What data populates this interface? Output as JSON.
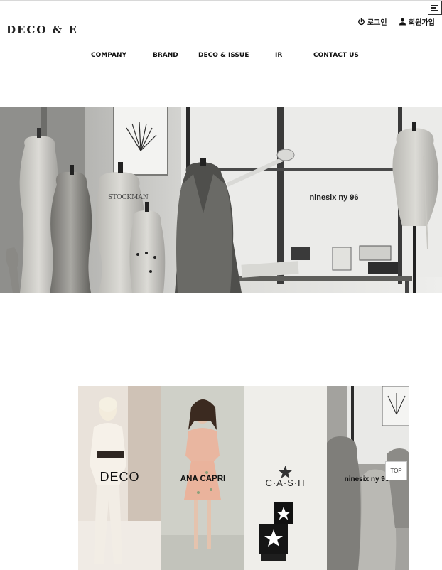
{
  "header": {
    "logo": "DECO & E",
    "util": {
      "login": "로그인",
      "join": "회원가입"
    }
  },
  "nav": {
    "items": [
      {
        "label": "COMPANY"
      },
      {
        "label": "BRAND"
      },
      {
        "label": "DECO & ISSUE"
      },
      {
        "label": "IR"
      },
      {
        "label": "CONTACT US"
      }
    ]
  },
  "hero": {
    "overlay_text": "ninesix ny 96"
  },
  "brands": [
    {
      "label": "DECO"
    },
    {
      "label": "ANA CAPRI"
    },
    {
      "label": "C·A·S·H"
    },
    {
      "label": "ninesix ny 96"
    }
  ],
  "top_button": "TOP"
}
